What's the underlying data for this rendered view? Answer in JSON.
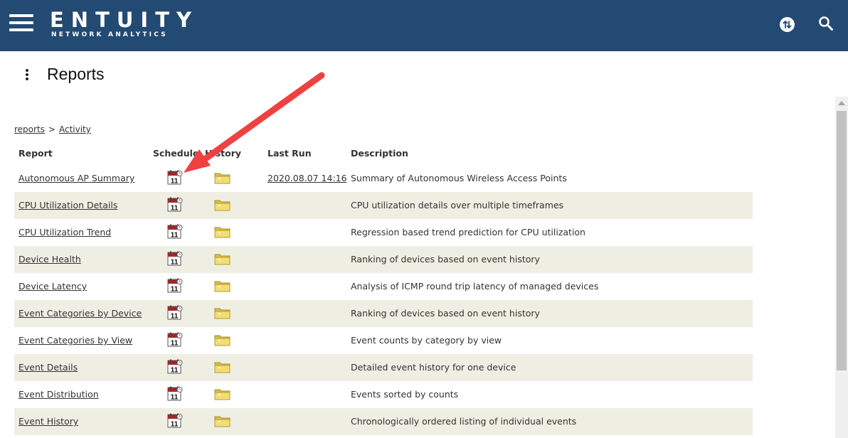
{
  "app": {
    "logo_main": "ENTUITY",
    "logo_sub": "NETWORK ANALYTICS",
    "brand_color": "#234a73"
  },
  "header_icons": [
    "menu-icon",
    "sync-icon",
    "search-icon"
  ],
  "page": {
    "title": "Reports"
  },
  "breadcrumb": {
    "root": "reports",
    "separator": ">",
    "current": "Activity"
  },
  "table": {
    "columns": {
      "report": "Report",
      "schedule": "Schedule",
      "history": "History",
      "last_run": "Last Run",
      "description": "Description"
    },
    "rows": [
      {
        "report": "Autonomous AP Summary",
        "last_run": "2020.08.07 14:16",
        "description": "Summary of Autonomous Wireless Access Points"
      },
      {
        "report": "CPU Utilization Details",
        "last_run": "",
        "description": "CPU utilization details over multiple timeframes"
      },
      {
        "report": "CPU Utilization Trend",
        "last_run": "",
        "description": "Regression based trend prediction for CPU utilization"
      },
      {
        "report": "Device Health",
        "last_run": "",
        "description": "Ranking of devices based on event history"
      },
      {
        "report": "Device Latency",
        "last_run": "",
        "description": "Analysis of ICMP round trip latency of managed devices"
      },
      {
        "report": "Event Categories by Device",
        "last_run": "",
        "description": "Ranking of devices based on event history"
      },
      {
        "report": "Event Categories by View",
        "last_run": "",
        "description": "Event counts by category by view"
      },
      {
        "report": "Event Details",
        "last_run": "",
        "description": "Detailed event history for one device"
      },
      {
        "report": "Event Distribution",
        "last_run": "",
        "description": "Events sorted by counts"
      },
      {
        "report": "Event History",
        "last_run": "",
        "description": "Chronologically ordered listing of individual events"
      }
    ],
    "schedule_icon": "calendar-icon",
    "schedule_icon_day": "11",
    "history_icon": "folder-icon",
    "shaded_row_color": "#efeee3"
  },
  "annotation": {
    "arrow_color": "#ef4141"
  }
}
